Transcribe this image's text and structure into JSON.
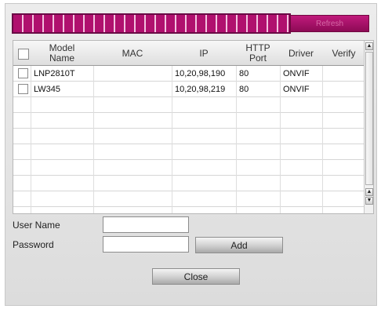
{
  "header": {
    "progress_fraction": 1.0,
    "refresh_label": "Refresh",
    "accent_color": "#b0106e"
  },
  "table": {
    "columns": [
      "Model\nName",
      "MAC",
      "IP",
      "HTTP\nPort",
      "Driver",
      "Verify"
    ],
    "rows": [
      {
        "model": "LNP2810T",
        "mac": "",
        "ip": "10,20,98,190",
        "port": "80",
        "driver": "ONVIF",
        "verify": ""
      },
      {
        "model": "LW345",
        "mac": "",
        "ip": "10,20,98,219",
        "port": "80",
        "driver": "ONVIF",
        "verify": ""
      }
    ],
    "empty_rows": 7
  },
  "form": {
    "user_name_label": "User Name",
    "user_name_value": "",
    "password_label": "Password",
    "password_value": "",
    "add_label": "Add"
  },
  "footer": {
    "close_label": "Close"
  }
}
